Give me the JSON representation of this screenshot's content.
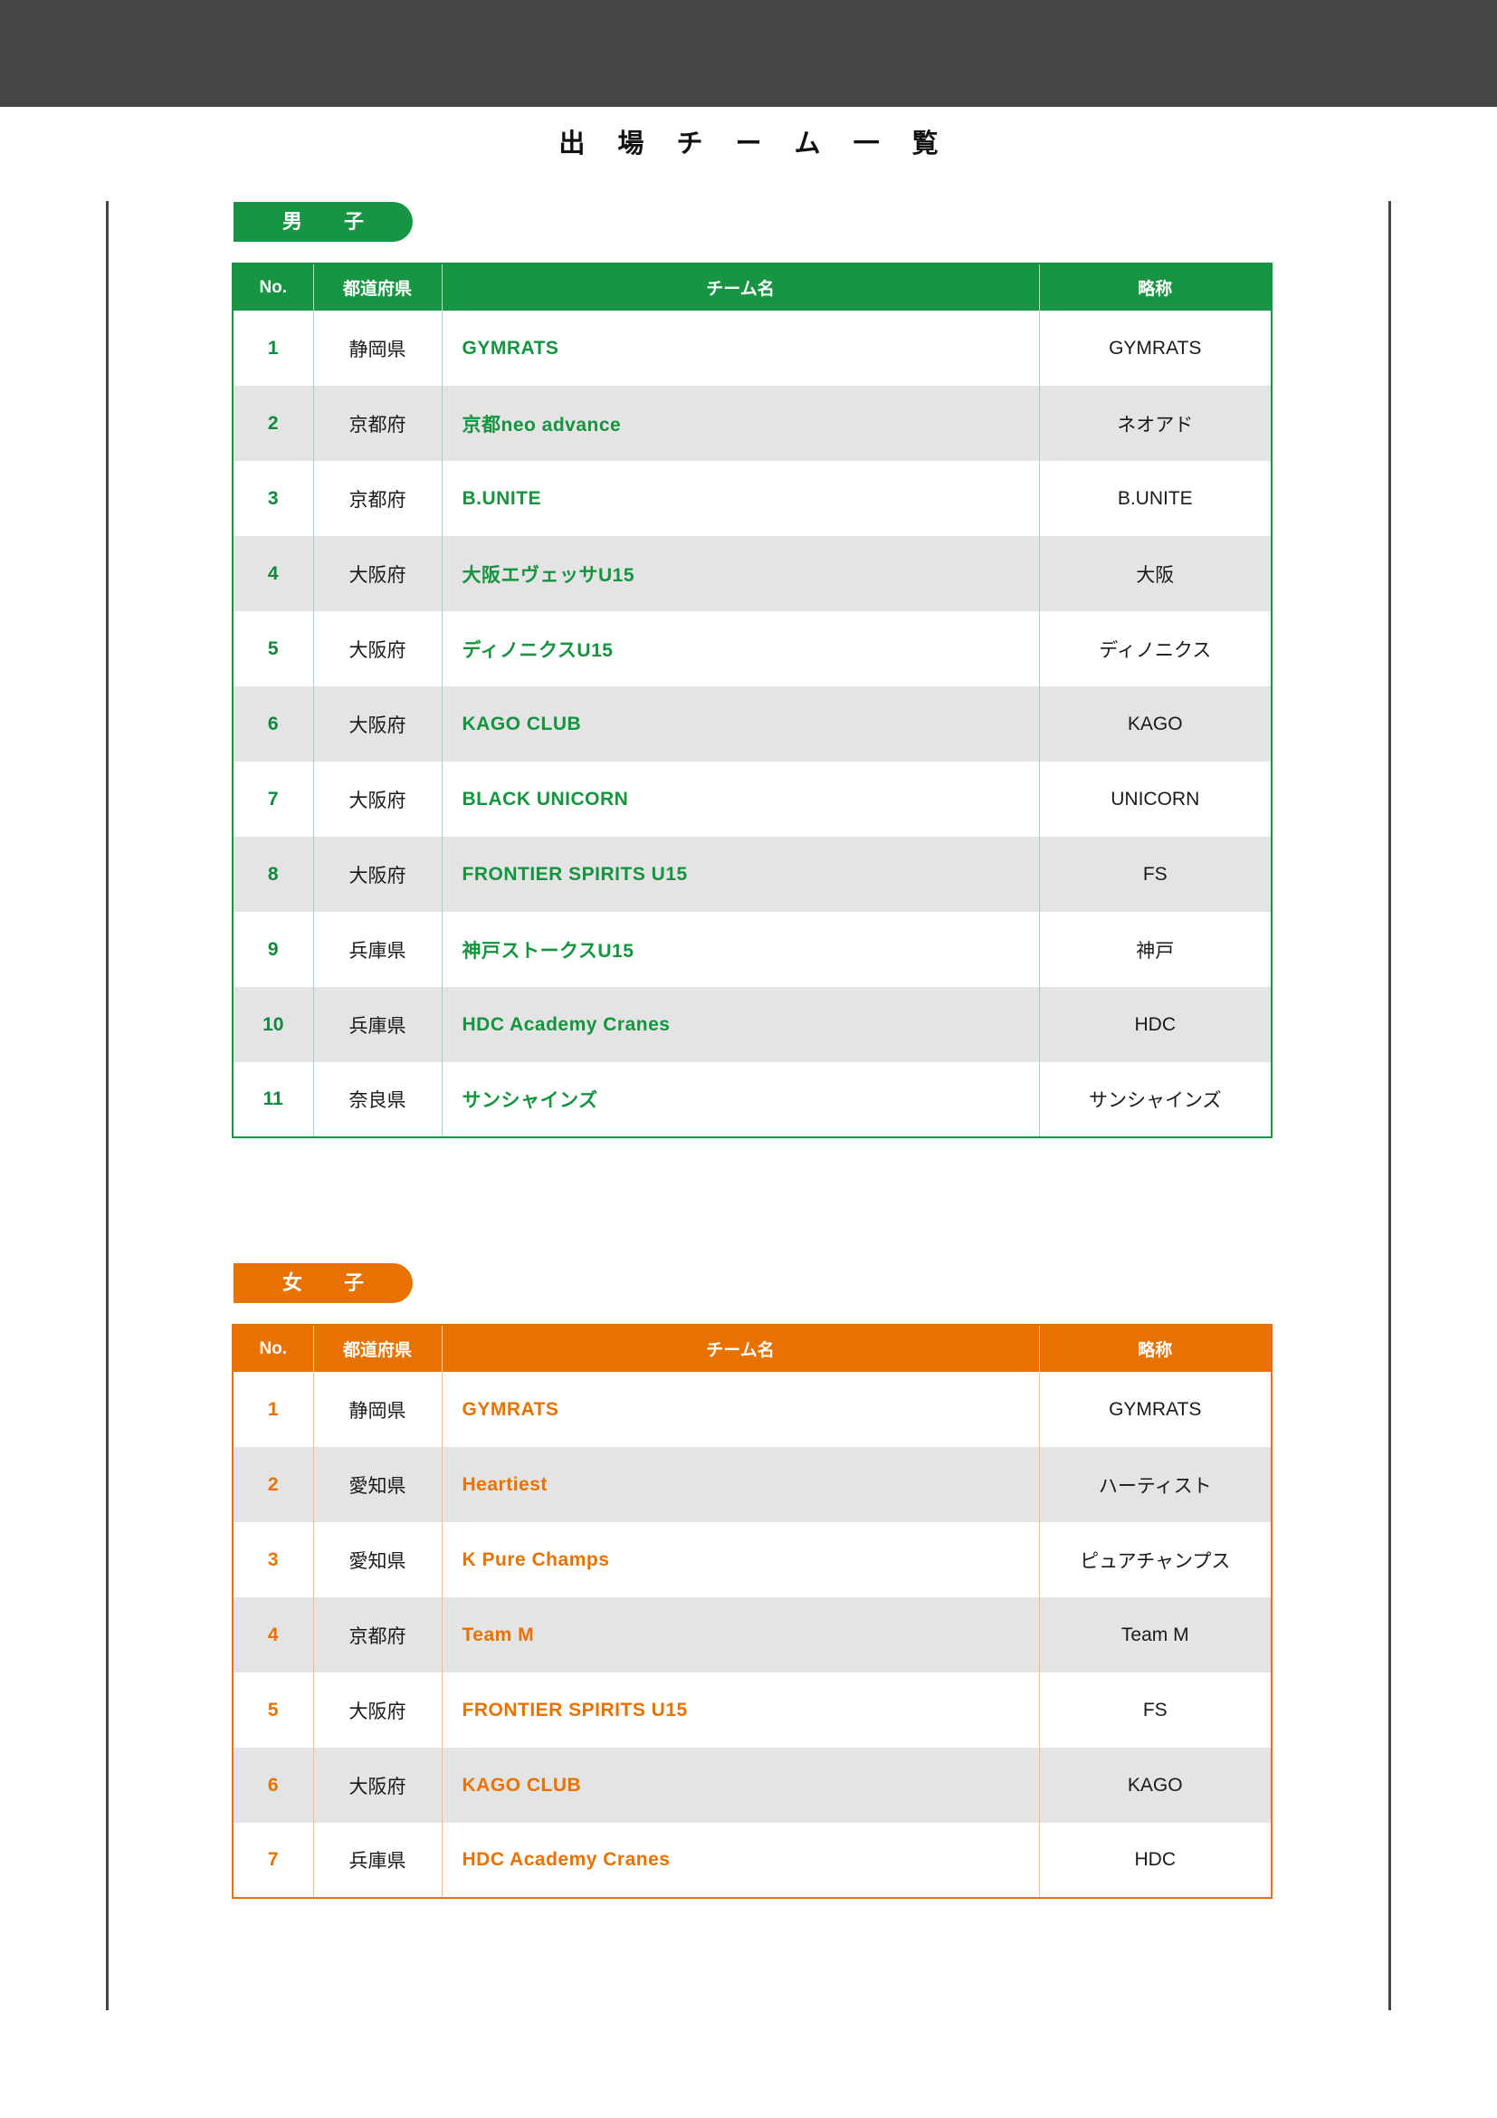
{
  "page": {
    "title": "出 場 チ ー ム 一 覧",
    "accent_green": "#189543",
    "accent_orange": "#e87200",
    "band_color": "#454545"
  },
  "sections": [
    {
      "badge": "男　子",
      "color": "#189543",
      "columns": [
        "No.",
        "都道府県",
        "チーム名",
        "略称"
      ],
      "rows": [
        {
          "no": "1",
          "pref": "静岡県",
          "name": "GYMRATS",
          "abbr": "GYMRATS"
        },
        {
          "no": "2",
          "pref": "京都府",
          "name": "京都neo advance",
          "abbr": "ネオアド"
        },
        {
          "no": "3",
          "pref": "京都府",
          "name": "B.UNITE",
          "abbr": "B.UNITE"
        },
        {
          "no": "4",
          "pref": "大阪府",
          "name": "大阪エヴェッサU15",
          "abbr": "大阪"
        },
        {
          "no": "5",
          "pref": "大阪府",
          "name": "ディノニクスU15",
          "abbr": "ディノニクス"
        },
        {
          "no": "6",
          "pref": "大阪府",
          "name": "KAGO CLUB",
          "abbr": "KAGO"
        },
        {
          "no": "7",
          "pref": "大阪府",
          "name": "BLACK UNICORN",
          "abbr": "UNICORN"
        },
        {
          "no": "8",
          "pref": "大阪府",
          "name": "FRONTIER SPIRITS U15",
          "abbr": "FS"
        },
        {
          "no": "9",
          "pref": "兵庫県",
          "name": "神戸ストークスU15",
          "abbr": "神戸"
        },
        {
          "no": "10",
          "pref": "兵庫県",
          "name": "HDC Academy Cranes",
          "abbr": "HDC"
        },
        {
          "no": "11",
          "pref": "奈良県",
          "name": "サンシャインズ",
          "abbr": "サンシャインズ"
        }
      ]
    },
    {
      "badge": "女　子",
      "color": "#e87200",
      "columns": [
        "No.",
        "都道府県",
        "チーム名",
        "略称"
      ],
      "rows": [
        {
          "no": "1",
          "pref": "静岡県",
          "name": "GYMRATS",
          "abbr": "GYMRATS"
        },
        {
          "no": "2",
          "pref": "愛知県",
          "name": "Heartiest",
          "abbr": "ハーティスト"
        },
        {
          "no": "3",
          "pref": "愛知県",
          "name": "K Pure Champs",
          "abbr": "ピュアチャンプス"
        },
        {
          "no": "4",
          "pref": "京都府",
          "name": "Team M",
          "abbr": "Team M"
        },
        {
          "no": "5",
          "pref": "大阪府",
          "name": "FRONTIER SPIRITS U15",
          "abbr": "FS"
        },
        {
          "no": "6",
          "pref": "大阪府",
          "name": "KAGO CLUB",
          "abbr": "KAGO"
        },
        {
          "no": "7",
          "pref": "兵庫県",
          "name": "HDC Academy Cranes",
          "abbr": "HDC"
        }
      ]
    }
  ]
}
